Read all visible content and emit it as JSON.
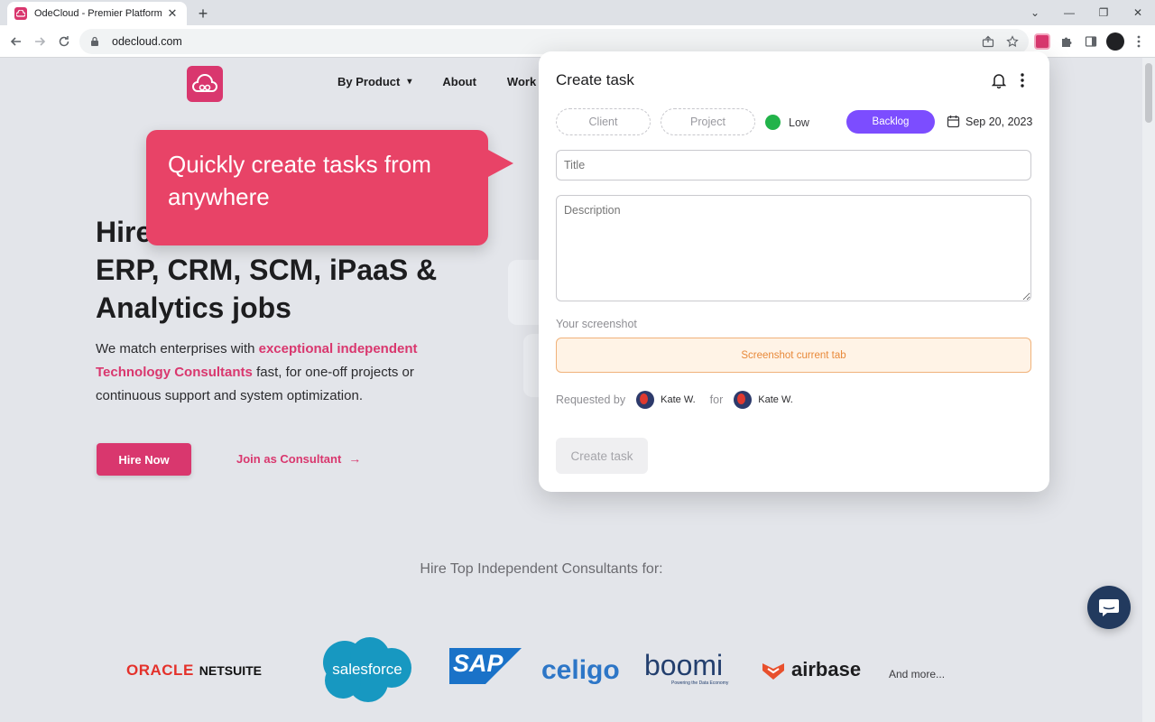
{
  "browser": {
    "tab_title": "OdeCloud - Premier Platform for",
    "url": "odecloud.com",
    "new_tab": "+",
    "close_tab": "✕",
    "win_min": "—",
    "win_max": "❐",
    "win_close": "✕",
    "tab_search": "⌄"
  },
  "site": {
    "nav": {
      "by_product": "By Product",
      "about": "About",
      "work": "Work"
    },
    "hero": {
      "title_line1": "Hire",
      "title_line2": "ERP, CRM, SCM, iPaaS &",
      "title_line3": "Analytics jobs",
      "desc_part1": "We match enterprises with ",
      "desc_highlight": "exceptional independent Technology Consultants",
      "desc_part2": " fast, for one-off projects or continuous support and system optimization.",
      "hire_button": "Hire Now",
      "join_link": "Join as Consultant"
    },
    "consultants_heading": "Hire Top Independent Consultants for:",
    "logos": {
      "oracle": "ORACLE",
      "netsuite": "NETSUITE",
      "salesforce": "salesforce",
      "sap": "SAP",
      "celigo": "celigo",
      "boomi": "boomi",
      "boomi_tagline": "Powering the Data Economy",
      "airbase": "airbase",
      "more": "And more..."
    }
  },
  "callout": {
    "text": "Quickly create tasks from anywhere"
  },
  "task_panel": {
    "title": "Create task",
    "client_chip": "Client",
    "project_chip": "Project",
    "priority": "Low",
    "priority_color": "#22b34a",
    "status": "Backlog",
    "status_color": "#7c4dff",
    "date": "Sep 20, 2023",
    "title_placeholder": "Title",
    "description_placeholder": "Description",
    "screenshot_label": "Your screenshot",
    "screenshot_button": "Screenshot current tab",
    "requested_by_label": "Requested by",
    "requested_by_name": "Kate W.",
    "for_label": "for",
    "for_name": "Kate W.",
    "create_button": "Create task"
  },
  "colors": {
    "brand_pink": "#d9376e",
    "callout_pink": "#e84367",
    "chat_navy": "#223a5e"
  }
}
